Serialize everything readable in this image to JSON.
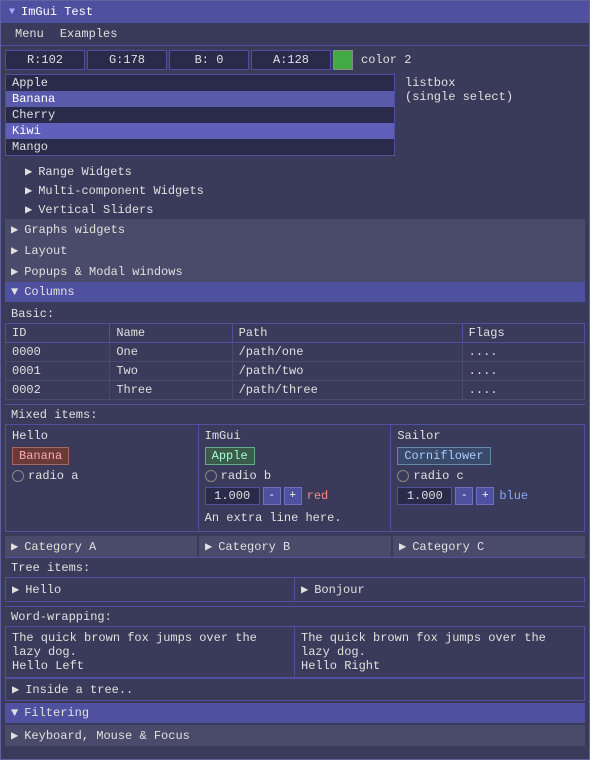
{
  "window": {
    "title": "ImGui Test",
    "arrow": "▼"
  },
  "menu": {
    "items": [
      "Menu",
      "Examples"
    ]
  },
  "color_row": {
    "r_label": "R:102",
    "g_label": "G:178",
    "b_label": "B:  0",
    "a_label": "A:128",
    "color2_label": "color 2"
  },
  "listbox": {
    "items": [
      "Apple",
      "Banana",
      "Cherry",
      "Kiwi",
      "Mango"
    ],
    "selected_index": 3,
    "info_label": "listbox",
    "info_sub": "(single select)"
  },
  "widgets": {
    "range_label": "Range Widgets",
    "multicomp_label": "Multi-component Widgets",
    "vertical_label": "Vertical Sliders"
  },
  "sections": [
    {
      "label": "Graphs widgets",
      "expanded": false
    },
    {
      "label": "Layout",
      "expanded": false
    },
    {
      "label": "Popups & Modal windows",
      "expanded": false
    }
  ],
  "columns": {
    "label": "Columns",
    "expanded": true,
    "basic_label": "Basic:",
    "table_headers": [
      "ID",
      "Name",
      "Path",
      "Flags"
    ],
    "table_rows": [
      {
        "id": "0000",
        "name": "One",
        "path": "/path/one",
        "flags": "...."
      },
      {
        "id": "0001",
        "name": "Two",
        "path": "/path/two",
        "flags": "...."
      },
      {
        "id": "0002",
        "name": "Three",
        "path": "/path/three",
        "flags": "...."
      }
    ]
  },
  "mixed_items": {
    "label": "Mixed items:",
    "col1": {
      "header": "Hello",
      "tag": "Banana",
      "radio_label": "radio a"
    },
    "col2": {
      "header": "ImGui",
      "tag": "Apple",
      "radio_label": "radio b",
      "stepper_value": "1.000",
      "stepper_minus": "-",
      "stepper_plus": "+",
      "stepper_color": "red",
      "extra_line": "An extra line here."
    },
    "col3": {
      "header": "Sailor",
      "tag": "Corniflower",
      "radio_label": "radio c",
      "stepper_value": "1.000",
      "stepper_minus": "-",
      "stepper_plus": "+",
      "stepper_color": "blue"
    },
    "categories": [
      "Category A",
      "Category B",
      "Category C"
    ]
  },
  "tree_items": {
    "label": "Tree items:",
    "col1": {
      "item": "Hello"
    },
    "col2": {
      "item": "Bonjour"
    }
  },
  "word_wrap": {
    "label": "Word-wrapping:",
    "col1_text": "The quick brown fox jumps over the lazy dog.",
    "col1_sub": "Hello Left",
    "col2_text": "The quick brown fox jumps over the lazy dog.",
    "col2_sub": "Hello Right"
  },
  "inside_tree": {
    "label": "Inside a tree.."
  },
  "filtering": {
    "label": "Filtering",
    "expanded": true
  },
  "keyboard": {
    "label": "Keyboard, Mouse & Focus"
  }
}
